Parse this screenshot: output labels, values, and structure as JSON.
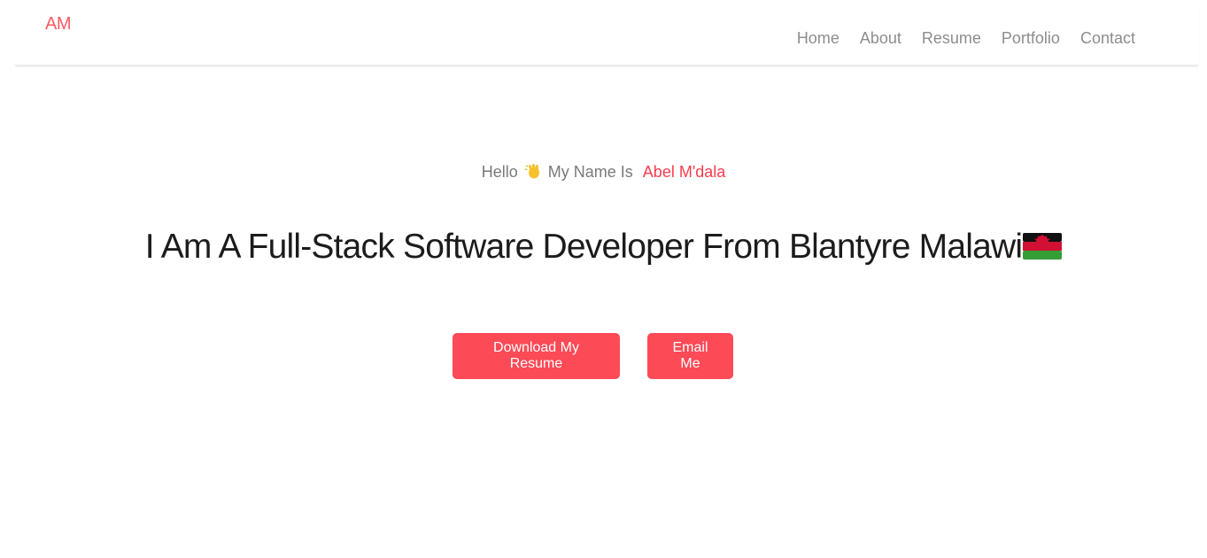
{
  "brand": {
    "label": "AM",
    "color": "#fc5b62"
  },
  "nav": {
    "items": [
      {
        "label": "Home"
      },
      {
        "label": "About"
      },
      {
        "label": "Resume"
      },
      {
        "label": "Portfolio"
      },
      {
        "label": "Contact"
      }
    ]
  },
  "hero": {
    "greeting_prefix": "Hello",
    "wave_icon": "waving-hand-icon",
    "greeting_middle": "My Name Is",
    "name": "Abel M'dala",
    "headline": "I Am A Full-Stack Software Developer From Blantyre Malawi",
    "flag_icon": "malawi-flag-icon",
    "buttons": {
      "resume_label": "Download My Resume",
      "email_label": "Email Me"
    }
  },
  "colors": {
    "accent": "#fc4a56",
    "name_accent": "#fc3c4c",
    "nav_text": "#8d8d8d"
  }
}
